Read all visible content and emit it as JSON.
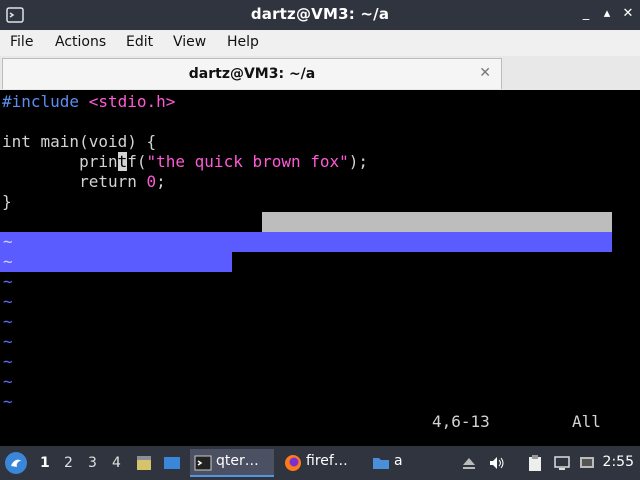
{
  "window": {
    "title": "dartz@VM3: ~/a",
    "app_icon": "terminal-icon"
  },
  "window_buttons": {
    "minimize": "_",
    "maximize": "▴",
    "close": "✕"
  },
  "menu": [
    "File",
    "Actions",
    "Edit",
    "View",
    "Help"
  ],
  "tab": {
    "label": "dartz@VM3: ~/a",
    "close": "✕"
  },
  "editor": {
    "line1_directive": "#include",
    "line1_header": " <stdio.h>",
    "line3_a": "int main(",
    "line3_void": "void",
    "line3_b": ") {",
    "line4_indent": "        prin",
    "line4_cursor": "t",
    "line4_f": "f(",
    "line4_string": "\"the quick brown fox\"",
    "line4_end": ");",
    "line5_a": "        return ",
    "line5_num": "0",
    "line5_b": ";",
    "line6": "}",
    "tilde": "~",
    "status_position": "4,6-13",
    "status_scroll": "All"
  },
  "taskbar": {
    "workspaces": [
      "1",
      "2",
      "3",
      "4"
    ],
    "tasks": [
      {
        "label": "qter…",
        "icon": "terminal-icon"
      },
      {
        "label": "firef…",
        "icon": "firefox-icon"
      },
      {
        "label": "a",
        "icon": "folder-icon"
      }
    ],
    "clock": "2:55"
  },
  "colors": {
    "titlebar": "#2f343f",
    "syntax_preproc": "#5b8ef0",
    "syntax_string": "#ff5ad6",
    "tilde": "#5b6cff",
    "visual_selection": "#5b5cff"
  }
}
